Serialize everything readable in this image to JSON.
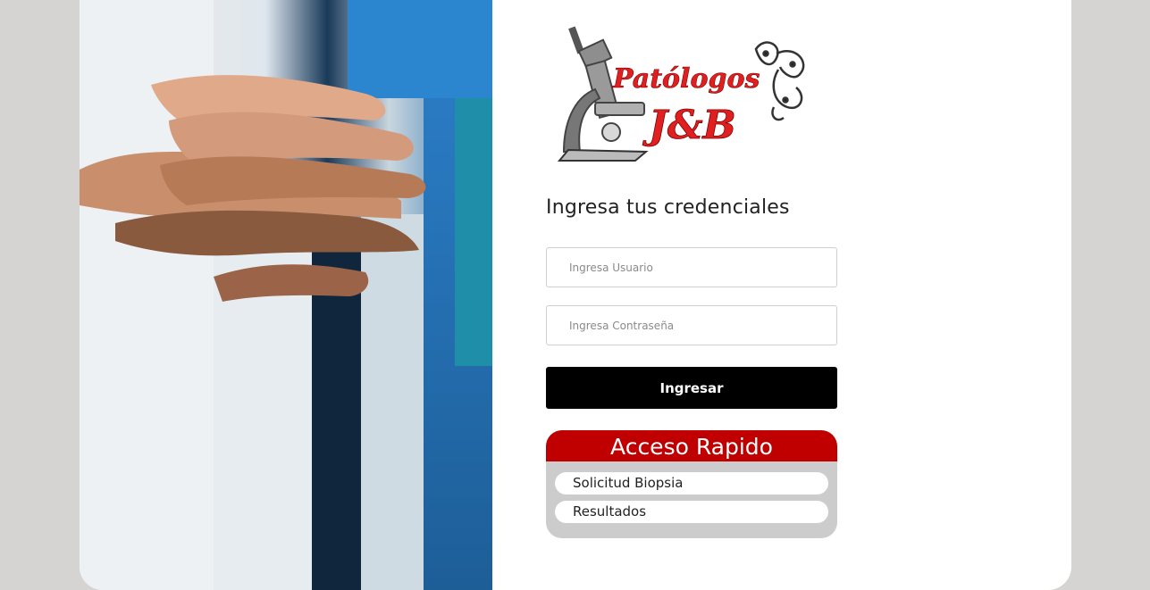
{
  "logo": {
    "brand_name": "Patólogos",
    "brand_initials": "J&B"
  },
  "login": {
    "heading": "Ingresa tus credenciales",
    "user_placeholder": "Ingresa Usuario",
    "password_placeholder": "Ingresa Contraseña",
    "submit_label": "Ingresar"
  },
  "quick_access": {
    "title": "Acceso Rapido",
    "links": [
      {
        "label": "Solicitud Biopsia"
      },
      {
        "label": "Resultados"
      }
    ]
  },
  "colors": {
    "page_background": "#d5d4d2",
    "card_background": "#ffffff",
    "accent_red": "#c00000",
    "button_black": "#000000",
    "quick_panel_grey": "#cccccc"
  },
  "icons": [
    "microscope-icon",
    "neuron-icon"
  ]
}
